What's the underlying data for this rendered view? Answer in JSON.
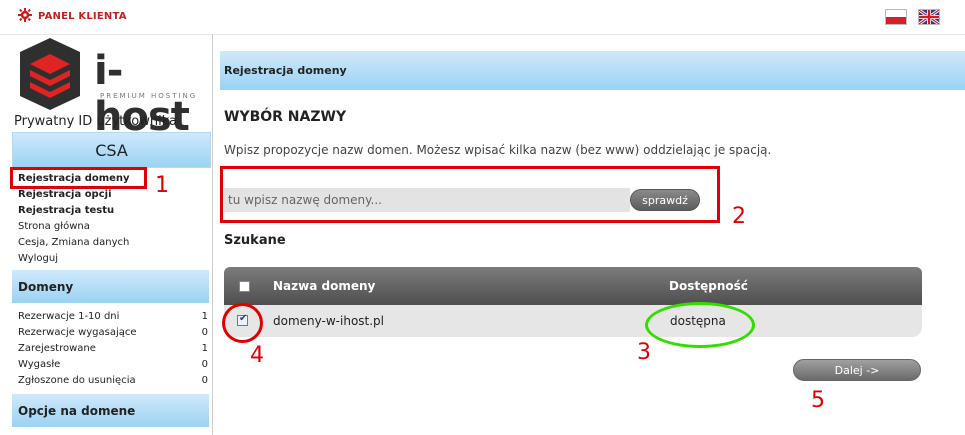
{
  "header": {
    "panel_label": "PANEL KLIENTA",
    "flags": [
      "pl-flag",
      "uk-flag"
    ]
  },
  "sidebar": {
    "logo_text": "i-host",
    "logo_tagline": "PREMIUM HOSTING",
    "user_id_label": "Prywatny ID użytkownika",
    "user_id_value": "CSA",
    "menu": [
      {
        "label": "Rejestracja domeny"
      },
      {
        "label": "Rejestracja opcji"
      },
      {
        "label": "Rejestracja testu"
      },
      {
        "label": "Strona główna"
      },
      {
        "label": "Cesja, Zmiana danych"
      },
      {
        "label": "Wyloguj"
      }
    ],
    "domains_title": "Domeny",
    "stats": [
      {
        "label": "Rezerwacje 1-10 dni",
        "value": "1"
      },
      {
        "label": "Rezerwacje wygasające",
        "value": "0"
      },
      {
        "label": "Zarejestrowane",
        "value": "1"
      },
      {
        "label": "Wygasłe",
        "value": "0"
      },
      {
        "label": "Zgłoszone do usunięcia",
        "value": "0"
      }
    ],
    "options_title": "Opcje na domene"
  },
  "main": {
    "header_title": "Rejestracja domeny",
    "section_title": "WYBÓR NAZWY",
    "hint": "Wpisz propozycje nazw domen. Możesz wpisać kilka nazw (bez www) oddzielając je spacją.",
    "search": {
      "placeholder": "tu wpisz nazwę domeny...",
      "value": "",
      "button": "sprawdź"
    },
    "searched_title": "Szukane",
    "table": {
      "col_name": "Nazwa domeny",
      "col_availability": "Dostępność",
      "rows": [
        {
          "domain": "domeny-w-ihost.pl",
          "availability": "dostępna",
          "checked": true
        }
      ]
    },
    "next_button": "Dalej ->"
  },
  "annotations": [
    "1",
    "2",
    "3",
    "4",
    "5"
  ],
  "colors": {
    "accent_red": "#e10000",
    "annotation_green": "#33dd00",
    "header_blue": "#9bd2f3"
  }
}
